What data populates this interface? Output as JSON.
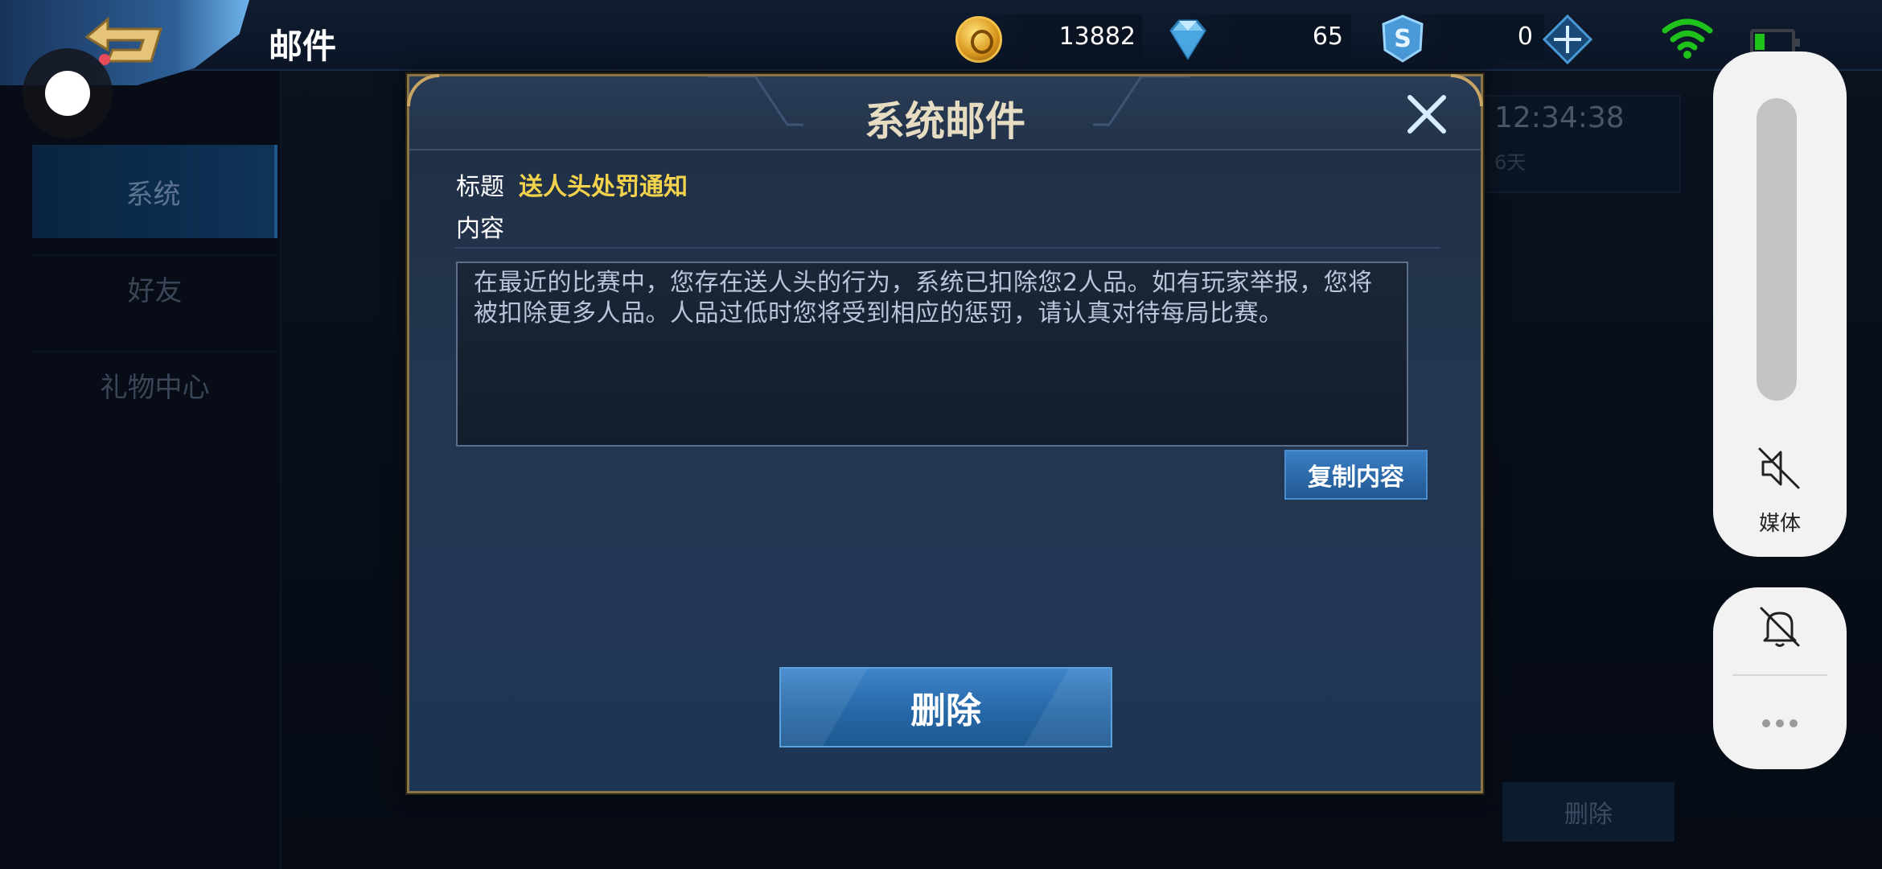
{
  "header": {
    "title": "邮件",
    "currencies": {
      "gold": "13882",
      "diamond": "65",
      "voucher": "0"
    },
    "icons": [
      "back-icon",
      "gold-coin-icon",
      "diamond-icon",
      "voucher-icon",
      "add-icon",
      "wifi-icon",
      "battery-icon"
    ]
  },
  "sidebar": {
    "items": [
      {
        "label": "系统",
        "active": true
      },
      {
        "label": "好友",
        "active": false
      },
      {
        "label": "礼物中心",
        "active": false
      }
    ]
  },
  "background_mail": {
    "time": "12:34:38",
    "expire": "6天",
    "delete_label": "删除"
  },
  "dialog": {
    "title": "系统邮件",
    "subject_label": "标题",
    "subject_value": "送人头处罚通知",
    "content_label": "内容",
    "content_text": "在最近的比赛中，您存在送人头的行为，系统已扣除您2人品。如有玩家举报，您将被扣除更多人品。人品过低时您将受到相应的惩罚，请认真对待每局比赛。",
    "copy_label": "复制内容",
    "delete_label": "删除"
  },
  "volume_overlay": {
    "media_label": "媒体",
    "level": 0,
    "muted": true
  },
  "colors": {
    "subject_accent": "#f3d24c",
    "button_blue": "#2668a8",
    "gold_border": "#8a7548"
  }
}
